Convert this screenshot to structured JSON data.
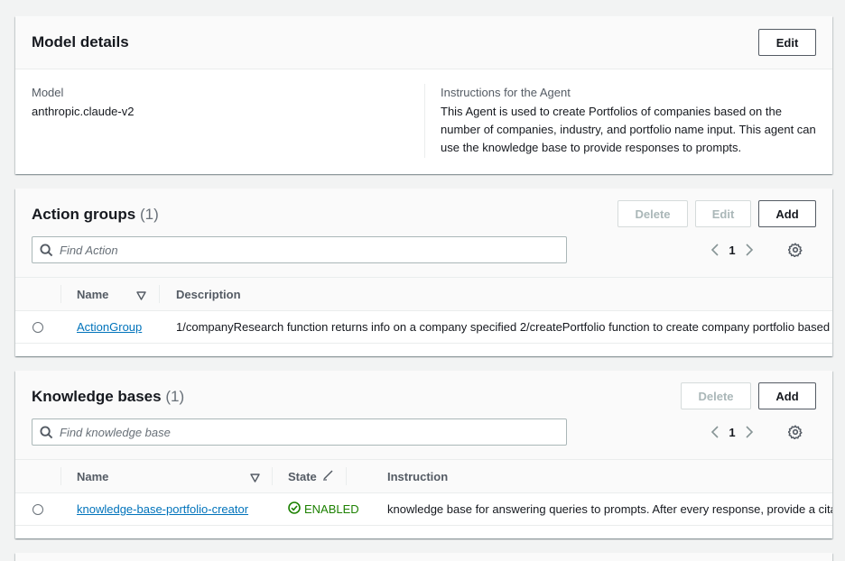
{
  "model_details": {
    "title": "Model details",
    "edit_label": "Edit",
    "model_label": "Model",
    "model_value": "anthropic.claude-v2",
    "instructions_label": "Instructions for the Agent",
    "instructions_value": "This Agent is used to create Portfolios of companies based on the number of companies, industry, and portfolio name input. This agent can use the knowledge base to provide responses to prompts."
  },
  "action_groups": {
    "title": "Action groups",
    "count": "(1)",
    "delete_label": "Delete",
    "edit_label": "Edit",
    "add_label": "Add",
    "search_placeholder": "Find Action",
    "page": "1",
    "columns": {
      "name": "Name",
      "description": "Description"
    },
    "rows": [
      {
        "name": "ActionGroup",
        "description": "1/companyResearch function returns info on a company specified 2/createPortfolio function to create company portfolio based"
      }
    ]
  },
  "knowledge_bases": {
    "title": "Knowledge bases",
    "count": "(1)",
    "delete_label": "Delete",
    "add_label": "Add",
    "search_placeholder": "Find knowledge base",
    "page": "1",
    "columns": {
      "name": "Name",
      "state": "State",
      "instruction": "Instruction"
    },
    "rows": [
      {
        "name": "knowledge-base-portfolio-creator",
        "state": "ENABLED",
        "instruction": "knowledge base for answering queries to prompts. After every response, provide a citation"
      }
    ]
  },
  "colors": {
    "link": "#0073bb",
    "success": "#1d8102",
    "border": "#eaeded",
    "header_bg": "#fafafa"
  },
  "icons": [
    "search-icon",
    "chevron-left-icon",
    "chevron-right-icon",
    "gear-icon",
    "sort-down-icon",
    "pencil-icon",
    "check-circle-icon"
  ]
}
